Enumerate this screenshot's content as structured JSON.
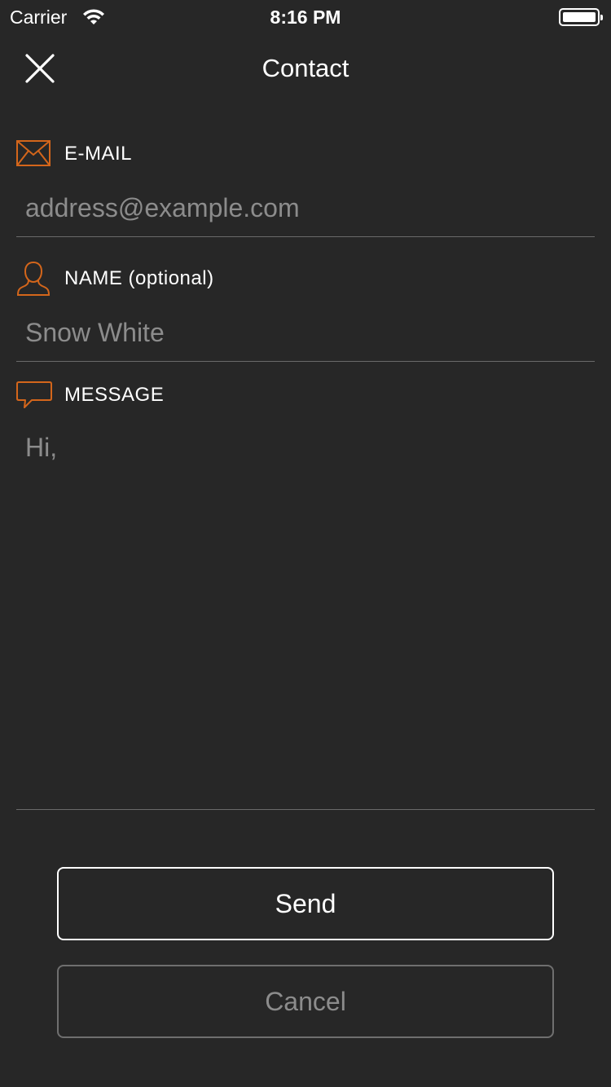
{
  "status_bar": {
    "carrier": "Carrier",
    "time": "8:16 PM",
    "wifi_icon": "wifi-icon",
    "battery_icon": "battery-icon"
  },
  "nav": {
    "title": "Contact",
    "close_icon": "close-icon"
  },
  "form": {
    "email": {
      "label": "E-MAIL",
      "placeholder": "address@example.com",
      "value": "",
      "icon": "envelope-icon"
    },
    "name": {
      "label": "NAME (optional)",
      "placeholder": "Snow White",
      "value": "",
      "icon": "person-icon"
    },
    "message": {
      "label": "MESSAGE",
      "placeholder": "",
      "value": "Hi,",
      "icon": "speech-bubble-icon"
    }
  },
  "actions": {
    "send_label": "Send",
    "cancel_label": "Cancel"
  },
  "colors": {
    "background": "#272727",
    "accent": "#d4661b",
    "text": "#ffffff",
    "placeholder": "#8c8c8c",
    "divider": "#6a6a6a"
  }
}
